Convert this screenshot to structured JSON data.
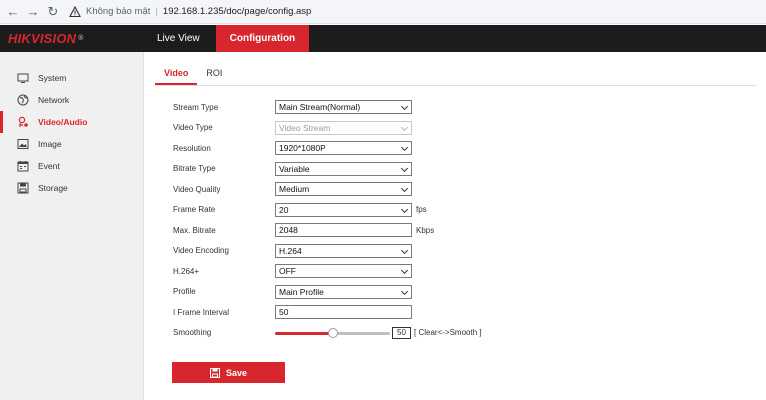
{
  "browser": {
    "security_label": "Không bảo mật",
    "url": "192.168.1.235/doc/page/config.asp"
  },
  "header": {
    "logo_hik": "HIK",
    "logo_vision": "VISION",
    "logo_reg": "®",
    "tabs": [
      {
        "label": "Live View",
        "active": false
      },
      {
        "label": "Configuration",
        "active": true
      }
    ]
  },
  "sidebar": {
    "items": [
      {
        "label": "System",
        "icon": "monitor-icon",
        "active": false
      },
      {
        "label": "Network",
        "icon": "globe-icon",
        "active": false
      },
      {
        "label": "Video/Audio",
        "icon": "microphone-icon",
        "active": true
      },
      {
        "label": "Image",
        "icon": "image-icon",
        "active": false
      },
      {
        "label": "Event",
        "icon": "calendar-icon",
        "active": false
      },
      {
        "label": "Storage",
        "icon": "floppy-icon",
        "active": false
      }
    ]
  },
  "subtabs": [
    {
      "label": "Video",
      "active": true
    },
    {
      "label": "ROI",
      "active": false
    }
  ],
  "form": {
    "stream_type": {
      "label": "Stream Type",
      "value": "Main Stream(Normal)"
    },
    "video_type": {
      "label": "Video Type",
      "value": "Video Stream"
    },
    "resolution": {
      "label": "Resolution",
      "value": "1920*1080P"
    },
    "bitrate_type": {
      "label": "Bitrate Type",
      "value": "Variable"
    },
    "video_quality": {
      "label": "Video Quality",
      "value": "Medium"
    },
    "frame_rate": {
      "label": "Frame Rate",
      "value": "20",
      "unit": "fps"
    },
    "max_bitrate": {
      "label": "Max. Bitrate",
      "value": "2048",
      "unit": "Kbps"
    },
    "video_encoding": {
      "label": "Video Encoding",
      "value": "H.264"
    },
    "h264_plus": {
      "label": "H.264+",
      "value": "OFF"
    },
    "profile": {
      "label": "Profile",
      "value": "Main Profile"
    },
    "i_frame_interval": {
      "label": "I Frame Interval",
      "value": "50"
    },
    "smoothing": {
      "label": "Smoothing",
      "value": "50",
      "level": 0.5,
      "hint": "[ Clear<->Smooth ]"
    }
  },
  "save_label": "Save",
  "colors": {
    "accent": "#d7262d",
    "header_bg": "#1c1c1c",
    "sidebar_bg": "#f0f0f0"
  }
}
